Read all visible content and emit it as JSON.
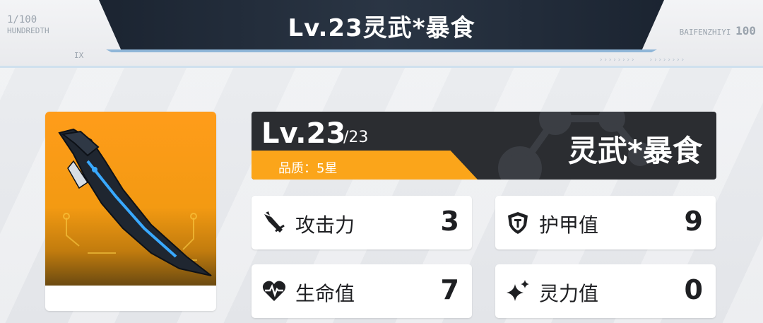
{
  "header": {
    "title": "Lv.23灵武*暴食",
    "left_deco_top": "1/100",
    "left_deco_word": "HUNDREDTH",
    "left_deco_small": "IX",
    "right_deco_top": "BAIFENZHIYI",
    "right_deco_num": "100"
  },
  "weapon": {
    "level": "Lv.23",
    "level_max": "/23",
    "quality": "品质：5星",
    "name": "灵武*暴食",
    "accent_color": "#fba51a",
    "header_color": "#2b2d31"
  },
  "stats": [
    {
      "icon": "sword-attack-icon",
      "label": "攻击力",
      "value": "3"
    },
    {
      "icon": "shield-icon",
      "label": "护甲值",
      "value": "9"
    },
    {
      "icon": "heart-pulse-icon",
      "label": "生命值",
      "value": "7"
    },
    {
      "icon": "sparkle-icon",
      "label": "灵力值",
      "value": "0"
    }
  ]
}
